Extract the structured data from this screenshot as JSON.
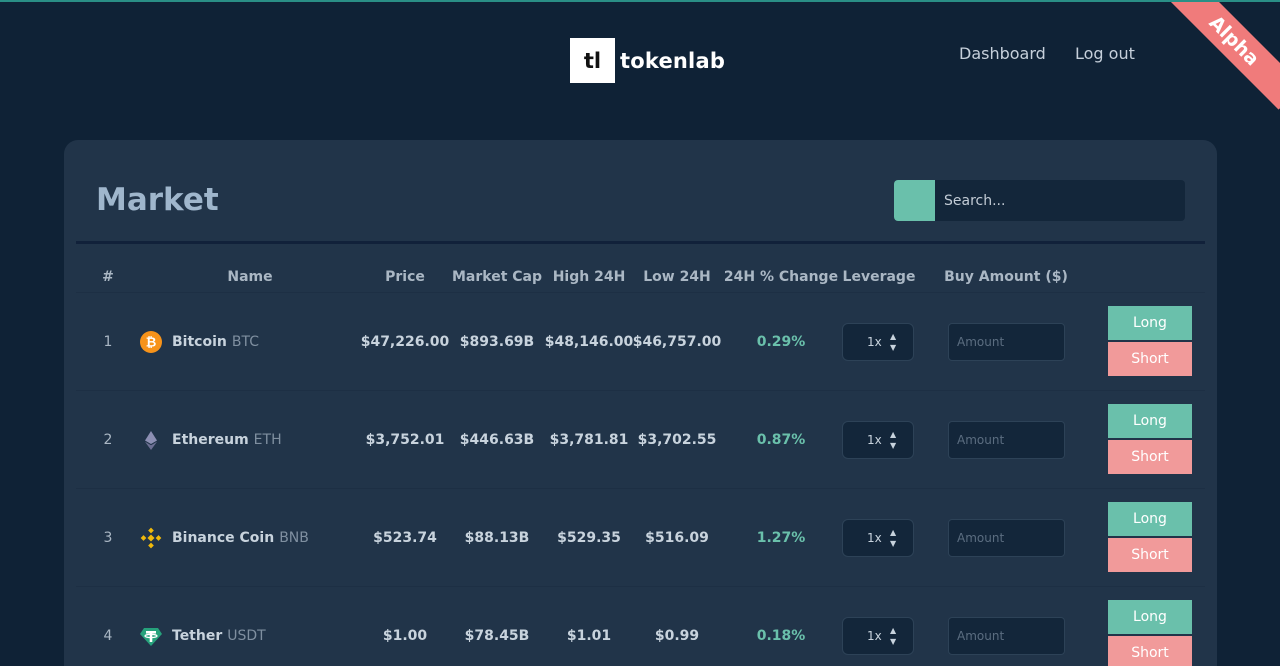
{
  "header": {
    "logo_mark": "tl",
    "logo_text": "tokenlab",
    "nav": {
      "dashboard": "Dashboard",
      "logout": "Log out"
    },
    "ribbon": "Alpha"
  },
  "market": {
    "title": "Market",
    "search_placeholder": "Search...",
    "columns": {
      "index": "#",
      "name": "Name",
      "price": "Price",
      "market_cap": "Market Cap",
      "high": "High 24H",
      "low": "Low 24H",
      "change": "24H % Change",
      "leverage": "Leverage",
      "buy_amount": "Buy Amount ($)"
    },
    "rows": [
      {
        "index": "1",
        "name": "Bitcoin",
        "symbol": "BTC",
        "icon": "bitcoin-icon",
        "price": "$47,226.00",
        "market_cap": "$893.69B",
        "high": "$48,146.00",
        "low": "$46,757.00",
        "change": "0.29%",
        "leverage": "1x",
        "amount_placeholder": "Amount",
        "long_label": "Long",
        "short_label": "Short"
      },
      {
        "index": "2",
        "name": "Ethereum",
        "symbol": "ETH",
        "icon": "ethereum-icon",
        "price": "$3,752.01",
        "market_cap": "$446.63B",
        "high": "$3,781.81",
        "low": "$3,702.55",
        "change": "0.87%",
        "leverage": "1x",
        "amount_placeholder": "Amount",
        "long_label": "Long",
        "short_label": "Short"
      },
      {
        "index": "3",
        "name": "Binance Coin",
        "symbol": "BNB",
        "icon": "binance-icon",
        "price": "$523.74",
        "market_cap": "$88.13B",
        "high": "$529.35",
        "low": "$516.09",
        "change": "1.27%",
        "leverage": "1x",
        "amount_placeholder": "Amount",
        "long_label": "Long",
        "short_label": "Short"
      },
      {
        "index": "4",
        "name": "Tether",
        "symbol": "USDT",
        "icon": "tether-icon",
        "price": "$1.00",
        "market_cap": "$78.45B",
        "high": "$1.01",
        "low": "$0.99",
        "change": "0.18%",
        "leverage": "1x",
        "amount_placeholder": "Amount",
        "long_label": "Long",
        "short_label": "Short"
      }
    ]
  },
  "colors": {
    "background": "#0f2236",
    "card": "#213449",
    "accent_green": "#6ac0ab",
    "accent_red": "#f19a9a",
    "ribbon": "#f07b7b"
  }
}
